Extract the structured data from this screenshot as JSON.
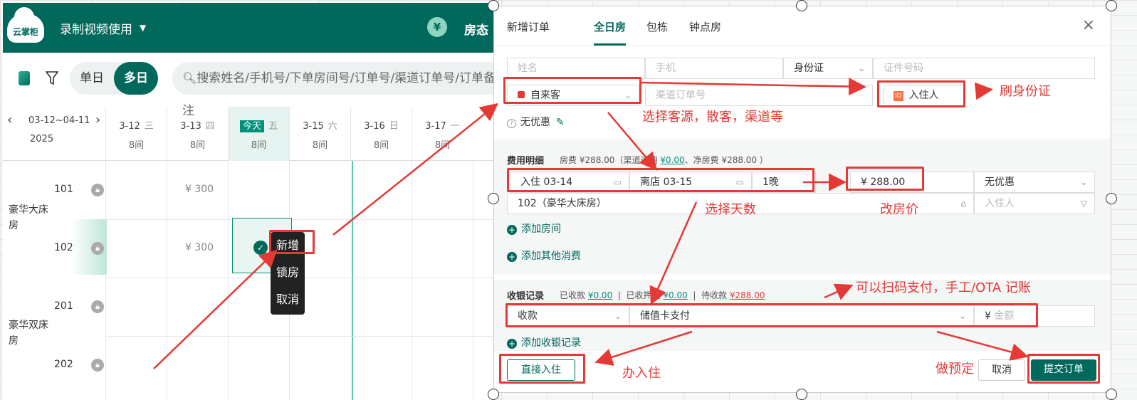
{
  "app": {
    "logo_text": "云掌柜",
    "shop_name": "录制视频使用",
    "yen": "¥",
    "room_status": "房态"
  },
  "toolbar": {
    "single_day": "单日",
    "multi_day": "多日",
    "search_placeholder": "搜索姓名/手机号/下单房间号/订单号/渠道订单号/订单备注"
  },
  "calendar": {
    "range": "03-12~04-11",
    "year": "2025",
    "prev": "‹",
    "next": "›",
    "days": [
      {
        "date": "3-12",
        "week": "三",
        "count": "8间"
      },
      {
        "date": "3-13",
        "week": "四",
        "count": "8间"
      },
      {
        "date": "今天",
        "week": "五",
        "count": "8间"
      },
      {
        "date": "3-15",
        "week": "六",
        "count": "8间"
      },
      {
        "date": "3-16",
        "week": "日",
        "count": "8间"
      },
      {
        "date": "3-17",
        "week": "一",
        "count": "8间"
      }
    ],
    "room_types": [
      "豪华大床房",
      "豪华双床房"
    ],
    "rooms": [
      "101",
      "102",
      "201",
      "202"
    ],
    "prices": [
      "¥ 300",
      "¥ 300"
    ],
    "context_menu": [
      "新增",
      "锁房",
      "取消"
    ]
  },
  "dialog": {
    "title": "新增订单",
    "tabs": [
      "全日房",
      "包栋",
      "钟点房"
    ],
    "close": "×",
    "name_ph": "姓名",
    "phone_ph": "手机",
    "id_type": "身份证",
    "id_ph": "证件号码",
    "source": "自来客",
    "channel_ph": "渠道订单号",
    "guest_btn": "入住人",
    "id_chip": "ID",
    "discount": "无优惠",
    "fee_label": "费用明细",
    "fee_meta": "房费 ¥288.00（渠道返佣",
    "fee_meta_link": "¥0.00",
    "fee_meta_tail": "、净房费 ¥288.00 ）",
    "checkin": "入住 03-14",
    "checkout": "离店 03-15",
    "nights": "1晚",
    "price": "¥  288.00",
    "discount2": "无优惠",
    "room": "102（豪华大床房）",
    "guest_ph": "入住人",
    "add_room": "添加房间",
    "add_other": "添加其他消费",
    "cash_label": "收银记录",
    "received_label": "已收款",
    "received": "¥0.00",
    "deposit_label": "已收押金",
    "deposit": "¥0.00",
    "pending_label": "待收款",
    "pending": "¥288.00",
    "pay_type": "收款",
    "pay_method": "储值卡支付",
    "amount_ph": "金额",
    "amount_yen": "¥",
    "add_cash": "添加收银记录",
    "checkin_btn": "直接入住",
    "cancel_btn": "取消",
    "submit_btn": "提交订单"
  },
  "annotations": {
    "swipe_id": "刷身份证",
    "source": "选择客源，散客，渠道等",
    "days": "选择天数",
    "price": "改房价",
    "pay": "可以扫码支付，手工/OTA 记账",
    "checkin": "办入住",
    "reserve": "做预定"
  }
}
